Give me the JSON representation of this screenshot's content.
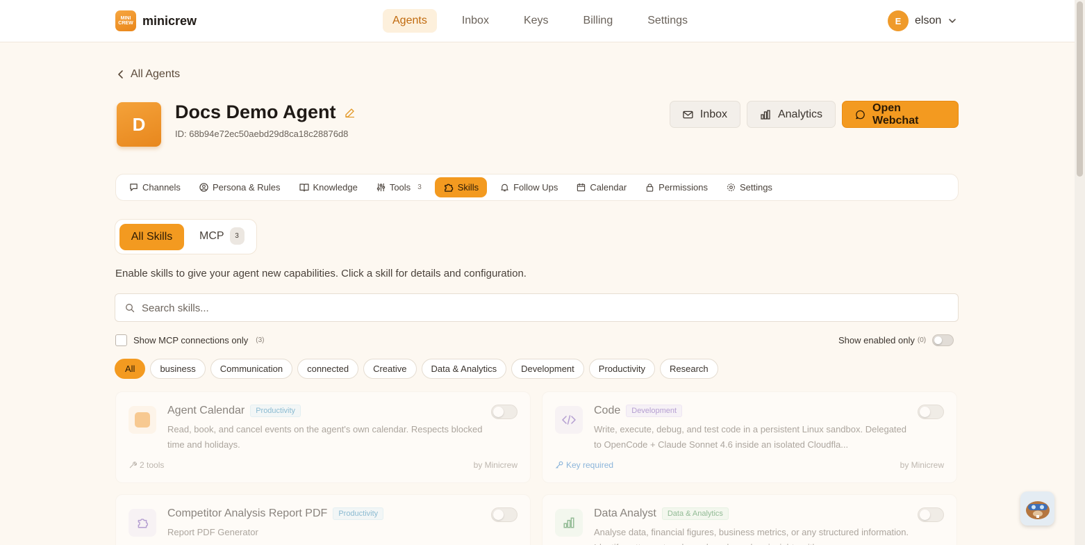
{
  "app": {
    "brand_name": "minicrew",
    "logo_line1": "MINI",
    "logo_line2": "CREW"
  },
  "nav": {
    "items": [
      "Agents",
      "Inbox",
      "Keys",
      "Billing",
      "Settings"
    ],
    "active": "Agents"
  },
  "user": {
    "initial": "E",
    "name": "elson"
  },
  "back_link": "All Agents",
  "agent": {
    "initial": "D",
    "name": "Docs Demo Agent",
    "id_text": "ID: 68b94e72ec50aebd29d8ca18c28876d8"
  },
  "header_buttons": {
    "inbox": "Inbox",
    "analytics": "Analytics",
    "open_webchat": "Open Webchat"
  },
  "tabs": [
    {
      "label": "Channels",
      "icon": "chat-icon"
    },
    {
      "label": "Persona & Rules",
      "icon": "user-circle-icon"
    },
    {
      "label": "Knowledge",
      "icon": "book-icon"
    },
    {
      "label": "Tools",
      "icon": "sliders-icon",
      "count": "3"
    },
    {
      "label": "Skills",
      "icon": "puzzle-icon",
      "active": true
    },
    {
      "label": "Follow Ups",
      "icon": "bell-icon"
    },
    {
      "label": "Calendar",
      "icon": "calendar-icon"
    },
    {
      "label": "Permissions",
      "icon": "lock-icon"
    },
    {
      "label": "Settings",
      "icon": "gear-icon"
    }
  ],
  "segments": {
    "all_label": "All Skills",
    "mcp_label": "MCP",
    "mcp_count": "3"
  },
  "intro_text": "Enable skills to give your agent new capabilities. Click a skill for details and configuration.",
  "search": {
    "placeholder": "Search skills..."
  },
  "filters": {
    "mcp_only_label": "Show MCP connections only",
    "mcp_only_count": "(3)",
    "enabled_only_label": "Show enabled only",
    "enabled_only_count": "(0)"
  },
  "categories": [
    "All",
    "business",
    "Communication",
    "connected",
    "Creative",
    "Data & Analytics",
    "Development",
    "Productivity",
    "Research"
  ],
  "skills": [
    {
      "name": "Agent Calendar",
      "tag": "Productivity",
      "description": "Read, book, and cancel events on the agent's own calendar. Respects blocked time and holidays.",
      "footer_left": "2 tools",
      "footer_right": "by Minicrew",
      "icon": "minicrew-logo-icon"
    },
    {
      "name": "Code",
      "tag": "Development",
      "description": "Write, execute, debug, and test code in a persistent Linux sandbox. Delegated to OpenCode + Claude Sonnet 4.6 inside an isolated Cloudfla...",
      "footer_left": "Key required",
      "footer_right": "by Minicrew",
      "icon": "code-icon"
    },
    {
      "name": "Competitor Analysis Report PDF",
      "tag": "Productivity",
      "description": "Report PDF Generator",
      "icon": "puzzle-icon"
    },
    {
      "name": "Data Analyst",
      "tag": "Data & Analytics",
      "description": "Analyse data, financial figures, business metrics, or any structured information. Identify patterns, trends, and produce clear insights with",
      "icon": "bar-chart-icon"
    }
  ],
  "colors": {
    "accent": "#f39a20",
    "background": "#fdf8f1",
    "text": "#2b2520"
  }
}
